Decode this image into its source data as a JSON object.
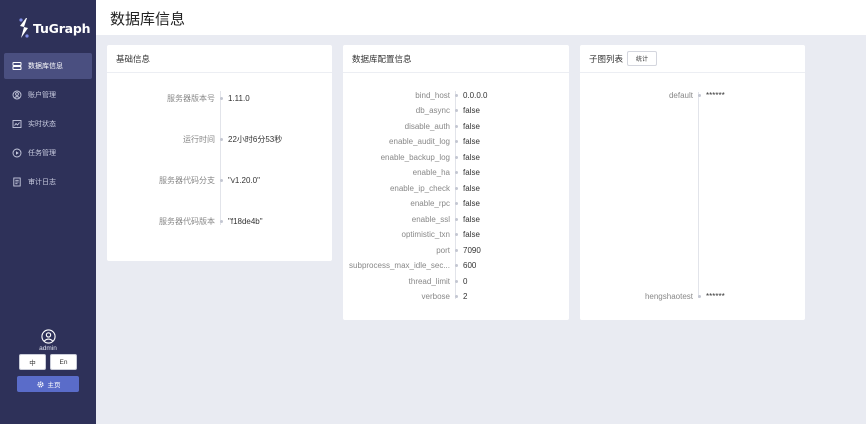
{
  "app": {
    "logo_text": "TuGraph"
  },
  "sidebar": {
    "items": [
      {
        "label": "数据库信息",
        "icon": "database-icon",
        "active": true
      },
      {
        "label": "账户管理",
        "icon": "user-circle-icon",
        "active": false
      },
      {
        "label": "实时状态",
        "icon": "monitor-chart-icon",
        "active": false
      },
      {
        "label": "任务管理",
        "icon": "play-circle-icon",
        "active": false
      },
      {
        "label": "审计日志",
        "icon": "document-list-icon",
        "active": false
      }
    ],
    "user": {
      "name": "admin"
    },
    "lang_zh": "中",
    "lang_en": "En",
    "home_label": "主页"
  },
  "header": {
    "title": "数据库信息"
  },
  "basic": {
    "title": "基础信息",
    "rows": [
      {
        "key": "服务器版本号",
        "value": "1.11.0"
      },
      {
        "key": "运行时间",
        "value": "22小时6分53秒"
      },
      {
        "key": "服务器代码分支",
        "value": "\"v1.20.0\""
      },
      {
        "key": "服务器代码版本",
        "value": "\"f18de4b\""
      }
    ]
  },
  "config": {
    "title": "数据库配置信息",
    "rows": [
      {
        "key": "bind_host",
        "value": "0.0.0.0"
      },
      {
        "key": "db_async",
        "value": "false"
      },
      {
        "key": "disable_auth",
        "value": "false"
      },
      {
        "key": "enable_audit_log",
        "value": "false"
      },
      {
        "key": "enable_backup_log",
        "value": "false"
      },
      {
        "key": "enable_ha",
        "value": "false"
      },
      {
        "key": "enable_ip_check",
        "value": "false"
      },
      {
        "key": "enable_rpc",
        "value": "false"
      },
      {
        "key": "enable_ssl",
        "value": "false"
      },
      {
        "key": "optimistic_txn",
        "value": "false"
      },
      {
        "key": "port",
        "value": "7090"
      },
      {
        "key": "subprocess_max_idle_sec...",
        "value": "600"
      },
      {
        "key": "thread_limit",
        "value": "0"
      },
      {
        "key": "verbose",
        "value": "2"
      }
    ]
  },
  "subgraphs": {
    "title": "子图列表",
    "stat_button": "统计",
    "rows": [
      {
        "key": "default",
        "value": "******"
      },
      {
        "key": "hengshaotest",
        "value": "******"
      }
    ]
  },
  "colors": {
    "sidebar_bg": "#2e3159",
    "active_item": "#4a4f80",
    "home_button": "#5a6cc9",
    "page_bg": "#e9ebf2"
  }
}
